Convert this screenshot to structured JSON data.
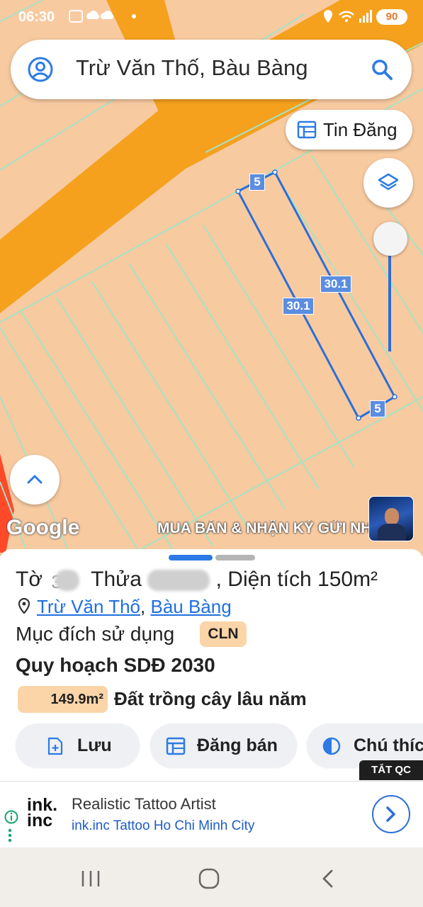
{
  "status_bar": {
    "time": "06:30",
    "battery": "90"
  },
  "search": {
    "query": "Trừ Văn Thố, Bàu Bàng"
  },
  "buttons": {
    "tin_dang": "Tin Đăng"
  },
  "map": {
    "edge_labels": [
      "5",
      "30.1",
      "30.1",
      "5"
    ],
    "attribution": "Google",
    "marquee": "MUA BÁN & NHẬN KÝ GỬI NHÀ ĐẤT"
  },
  "sheet": {
    "title_to": "Tờ",
    "title_to_suffix": "3",
    "title_thua": "Thửa",
    "title_dien_tich": ", Diện tích",
    "area": "150m²",
    "address_street": "Trừ Văn Thố",
    "address_sep": ", ",
    "address_district": "Bàu Bàng",
    "purpose_label": "Mục đích sử dụng",
    "purpose_code": "CLN",
    "plan_title": "Quy hoạch SDĐ 2030",
    "plan_area": "149.9m²",
    "plan_type": "Đất trồng cây lâu năm",
    "actions": [
      "Lưu",
      "Đăng bán",
      "Chú thích"
    ]
  },
  "ad": {
    "close_label": "TẮT QC",
    "logo_line1": "ink.",
    "logo_line2": "inc",
    "title": "Realistic Tattoo Artist",
    "subtitle": "ink.inc Tattoo Ho Chi Minh City"
  },
  "colors": {
    "accent": "#2c7be5",
    "road": "#f5a11e",
    "parcel": "#f8caa0",
    "parcel_line": "#a6e3c4",
    "badge": "#fbd4a8"
  }
}
